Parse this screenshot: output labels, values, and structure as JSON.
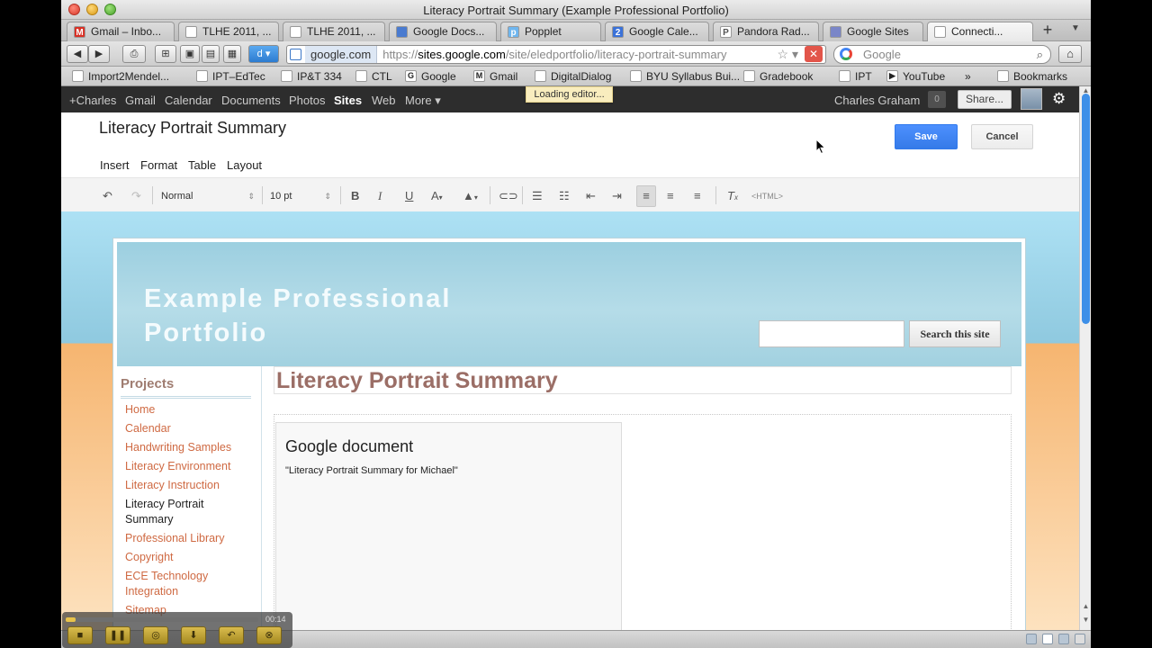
{
  "window": {
    "title": "Literacy Portrait Summary (Example Professional Portfolio)"
  },
  "tabs": [
    {
      "label": "Gmail – Inbo...",
      "icon": "gmail-icon",
      "color": "#d93025",
      "glyph": "M"
    },
    {
      "label": "TLHE 2011, ...",
      "icon": "page-icon",
      "color": "#ffffff",
      "glyph": ""
    },
    {
      "label": "TLHE 2011, ...",
      "icon": "page-icon",
      "color": "#ffffff",
      "glyph": ""
    },
    {
      "label": "Google Docs...",
      "icon": "docs-icon",
      "color": "#4a7bd0",
      "glyph": ""
    },
    {
      "label": "Popplet",
      "icon": "popplet-icon",
      "color": "#6fb6ef",
      "glyph": "p"
    },
    {
      "label": "Google Cale...",
      "icon": "calendar-icon",
      "color": "#3b72d9",
      "glyph": "2"
    },
    {
      "label": "Pandora Rad...",
      "icon": "pandora-icon",
      "color": "#ffffff",
      "glyph": "P"
    },
    {
      "label": "Google Sites",
      "icon": "sites-icon",
      "color": "#7a86c8",
      "glyph": ""
    },
    {
      "label": "Connecti...",
      "icon": "spinner-icon",
      "color": "#ffffff",
      "glyph": ""
    }
  ],
  "address": {
    "domain": "google.com",
    "scheme": "https://",
    "host": "sites.google.com",
    "path": "/site/eledportfolio/literacy-portrait-summary",
    "search_placeholder": "Google"
  },
  "bookmarks": [
    "Import2Mendel...",
    "IPT–EdTec",
    "IP&T 334",
    "CTL",
    "Google",
    "Gmail",
    "DigitalDialog",
    "BYU Syllabus Bui...",
    "Gradebook",
    "IPT",
    "YouTube",
    "Bookmarks"
  ],
  "gbar": {
    "links": [
      "+Charles",
      "Gmail",
      "Calendar",
      "Documents",
      "Photos",
      "Sites",
      "Web",
      "More ▾"
    ],
    "active": "Sites",
    "user": "Charles Graham",
    "count": "0",
    "share": "Share...",
    "loading": "Loading editor..."
  },
  "editor": {
    "title": "Literacy Portrait Summary",
    "save": "Save",
    "cancel": "Cancel",
    "menu": [
      "Insert",
      "Format",
      "Table",
      "Layout"
    ],
    "style": "Normal",
    "size": "10 pt",
    "html": "<HTML>"
  },
  "site": {
    "title": "Example Professional Portfolio",
    "search_button": "Search this site",
    "sidebar_title": "Projects",
    "nav": [
      "Home",
      "Calendar",
      "Handwriting Samples",
      "Literacy Environment",
      "Literacy Instruction",
      "Literacy Portrait Summary",
      "Professional Library",
      "Copyright",
      "ECE Technology Integration",
      "Sitemap"
    ],
    "current": "Literacy Portrait Summary",
    "page_title": "Literacy Portrait Summary",
    "gadget_title": "Google document",
    "gadget_sub": "\"Literacy Portrait Summary for Michael\""
  },
  "player": {
    "time": "00:14",
    "progress": 0.05
  },
  "colors": {
    "accent": "#4d90fe",
    "nav_link": "#cf6a43",
    "sidebar_title": "#9f7c70",
    "page_title": "#9b6e66"
  }
}
